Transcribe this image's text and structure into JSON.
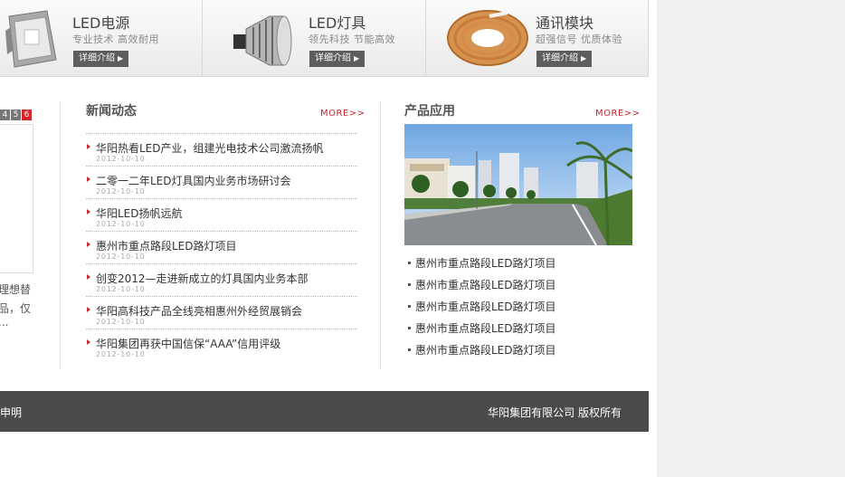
{
  "products": [
    {
      "title": "LED电源",
      "subtitle": "专业技术  高效耐用",
      "button": "详细介绍"
    },
    {
      "title": "LED灯具",
      "subtitle": "领先科技  节能高效",
      "button": "详细介绍"
    },
    {
      "title": "通讯模块",
      "subtitle": "超强信号  优质体验",
      "button": "详细介绍"
    }
  ],
  "left_fragment": {
    "pages": [
      "4",
      "5",
      "6"
    ],
    "lines": [
      "理想替",
      "品，仅",
      "..."
    ]
  },
  "news": {
    "title": "新闻动态",
    "more": "MORE>>",
    "items": [
      {
        "title": "华阳热看LED产业，组建光电技术公司激流扬帆",
        "date": "2012-10-10"
      },
      {
        "title": "二零一二年LED灯具国内业务市场研讨会",
        "date": "2012-10-10"
      },
      {
        "title": "华阳LED扬帆远航",
        "date": "2012-10-10"
      },
      {
        "title": "惠州市重点路段LED路灯项目",
        "date": "2012-10-10"
      },
      {
        "title": "创变2012—走进新成立的灯具国内业务本部",
        "date": "2012-10-10"
      },
      {
        "title": "华阳高科技产品全线亮相惠州外经贸展销会",
        "date": "2012-10-10"
      },
      {
        "title": "华阳集团再获中国信保“AAA”信用评级",
        "date": "2012-10-10"
      }
    ]
  },
  "applications": {
    "title": "产品应用",
    "more": "MORE>>",
    "items": [
      "惠州市重点路段LED路灯项目",
      "惠州市重点路段LED路灯项目",
      "惠州市重点路段LED路灯项目",
      "惠州市重点路段LED路灯项目",
      "惠州市重点路段LED路灯项目"
    ]
  },
  "footer": {
    "left": "申明",
    "right": "华阳集团有限公司  版权所有"
  },
  "colors": {
    "accent": "#c8242a",
    "footer_bg": "#4a4a4a"
  }
}
